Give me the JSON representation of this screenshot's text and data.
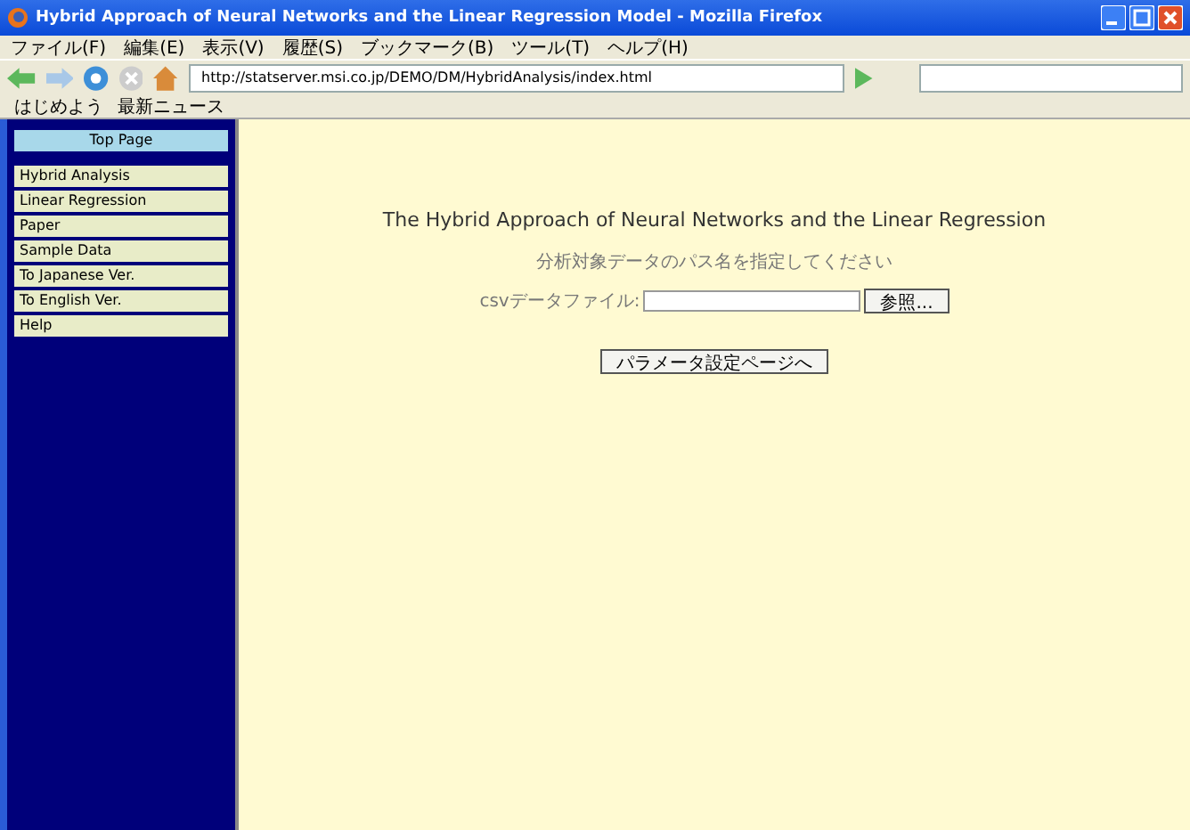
{
  "window": {
    "title": "Hybrid Approach of Neural Networks and the Linear Regression Model - Mozilla Firefox"
  },
  "menu": [
    "ファイル(F)",
    "編集(E)",
    "表示(V)",
    "履歴(S)",
    "ブックマーク(B)",
    "ツール(T)",
    "ヘルプ(H)"
  ],
  "address": {
    "value": "http://statserver.msi.co.jp/DEMO/DM/HybridAnalysis/index.html"
  },
  "bookmarks": [
    "はじめよう",
    "最新ニュース"
  ],
  "sidebar": {
    "top": "Top Page",
    "items": [
      "Hybrid Analysis",
      "Linear Regression",
      "Paper",
      "Sample Data",
      "To Japanese Ver.",
      "To English Ver.",
      "Help"
    ]
  },
  "main": {
    "heading": "The Hybrid Approach of Neural Networks and the Linear Regression",
    "instruction": "分析対象データのパス名を指定してください",
    "file_label": "csvデータファイル:",
    "browse_button": "参照...",
    "next_button": "パラメータ設定ページへ"
  }
}
